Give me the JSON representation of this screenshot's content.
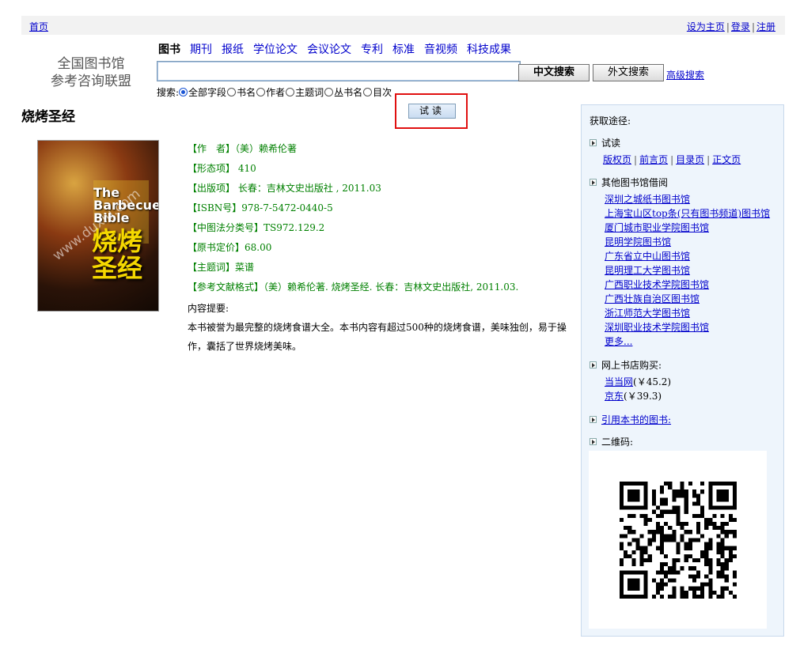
{
  "topbar": {
    "home": "首页",
    "set_home": "设为主页",
    "login": "登录",
    "register": "注册",
    "sep": "|"
  },
  "logo": {
    "line1": "全国图书馆",
    "line2": "参考咨询联盟"
  },
  "nav": {
    "tabs": [
      "图书",
      "期刊",
      "报纸",
      "学位论文",
      "会议论文",
      "专利",
      "标准",
      "音视频",
      "科技成果"
    ],
    "active": 0
  },
  "search": {
    "value": "",
    "btn_zh": "中文搜索",
    "btn_en": "外文搜索",
    "advanced": "高级搜索",
    "fields_label": "搜索:",
    "fields": [
      "全部字段",
      "书名",
      "作者",
      "主题词",
      "丛书名",
      "目次"
    ],
    "selected_field": 0
  },
  "book": {
    "title": "烧烤圣经",
    "trial_button": "试读",
    "cover_text_en": "The Barbecue! Bible",
    "cover_text_zh": "烧烤圣经",
    "cover_watermark": "www.duxiu.com",
    "details": [
      "【作　者】（美）赖希伦著",
      "【形态项】 410",
      "【出版项】 长春：吉林文史出版社 , 2011.03",
      "【ISBN号】978-7-5472-0440-5",
      "【中图法分类号】TS972.129.2",
      "【原书定价】68.00",
      "【主题词】菜谱",
      "【参考文献格式】（美）赖希伦著. 烧烤圣经. 长春：吉林文史出版社, 2011.03."
    ],
    "summary_label": "内容提要:",
    "summary": "本书被誉为最完整的烧烤食谱大全。本书内容有超过500种的烧烤食谱，美味独创，易于操作，囊括了世界烧烤美味。"
  },
  "sidebar": {
    "heading": "获取途径:",
    "trial": {
      "label": "试读",
      "links": [
        "版权页",
        "前言页",
        "目录页",
        "正文页"
      ]
    },
    "other_libs": {
      "label": "其他图书馆借阅",
      "libs": [
        "深圳之城纸书图书馆",
        "上海宝山区top条(只有图书频道)图书馆",
        "厦门城市职业学院图书馆",
        "昆明学院图书馆",
        "广东省立中山图书馆",
        "昆明理工大学图书馆",
        "广西职业技术学院图书馆",
        "广西壮族自治区图书馆",
        "浙江师范大学图书馆",
        "深圳职业技术学院图书馆",
        "更多..."
      ]
    },
    "shop": {
      "label": "网上书店购买:",
      "items": [
        {
          "name": "当当网",
          "price": "(￥45.2)"
        },
        {
          "name": "京东",
          "price": "(￥39.3)"
        }
      ]
    },
    "cite": "引用本书的图书:",
    "qr_label": "二维码:"
  }
}
